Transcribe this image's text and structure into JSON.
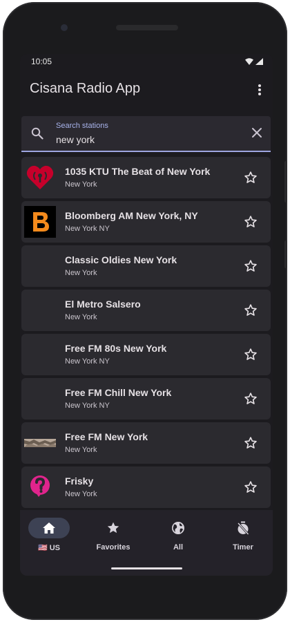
{
  "status_bar": {
    "time": "10:05"
  },
  "app_bar": {
    "title": "Cisana Radio App",
    "overflow_icon": "more-vert-icon"
  },
  "search": {
    "label": "Search stations",
    "value": "new york"
  },
  "stations": [
    {
      "name": "1035 KTU The Beat of New York",
      "location": "New York",
      "logo": "iheart-logo",
      "favorite": false
    },
    {
      "name": "Bloomberg AM New York, NY",
      "location": "New York NY",
      "logo": "bloomberg-logo",
      "favorite": false
    },
    {
      "name": "Classic Oldies New York",
      "location": "New York",
      "logo": "",
      "favorite": false
    },
    {
      "name": "El Metro Salsero",
      "location": "New York",
      "logo": "",
      "favorite": false
    },
    {
      "name": "Free FM 80s New York",
      "location": "New York NY",
      "logo": "",
      "favorite": false
    },
    {
      "name": "Free FM Chill New York",
      "location": "New York NY",
      "logo": "",
      "favorite": false
    },
    {
      "name": "Free FM New York",
      "location": "New York",
      "logo": "freefm-logo",
      "favorite": false
    },
    {
      "name": "Frisky",
      "location": "New York",
      "logo": "frisky-logo",
      "favorite": false
    }
  ],
  "bottom_nav": [
    {
      "label": "🇺🇸 US",
      "icon": "home-icon",
      "active": true
    },
    {
      "label": "Favorites",
      "icon": "star-icon",
      "active": false
    },
    {
      "label": "All",
      "icon": "globe-icon",
      "active": false
    },
    {
      "label": "Timer",
      "icon": "timer-off-icon",
      "active": false
    }
  ],
  "colors": {
    "background": "#1c1b1f",
    "card": "#2b2a2f",
    "accent": "#a9b4ec",
    "iheart_red": "#c6002b",
    "bloomberg_orange": "#f48a1c",
    "frisky_pink": "#e0248c"
  }
}
